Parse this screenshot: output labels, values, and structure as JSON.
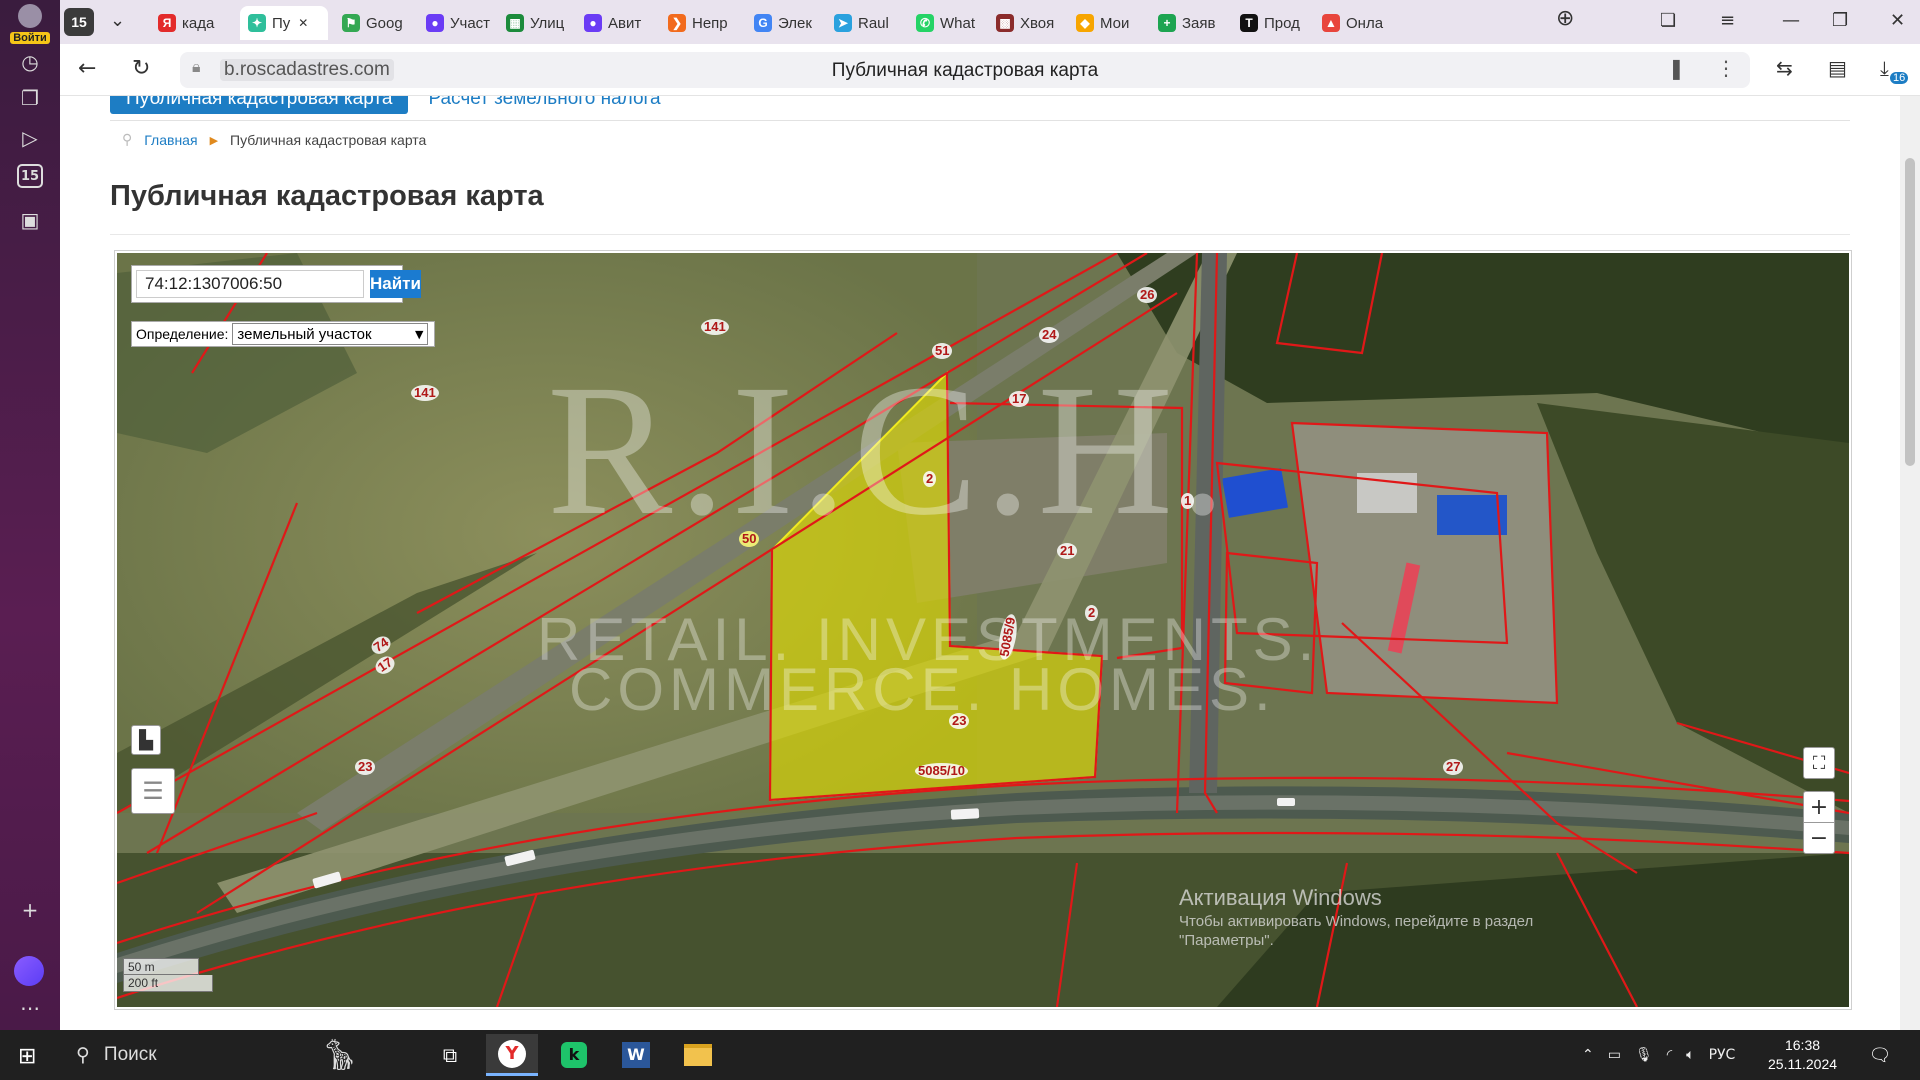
{
  "browser": {
    "profile_label": "Войти",
    "tab_count": "15",
    "tabs": [
      {
        "label": "када",
        "color": "#e32b2b",
        "glyph": "Я"
      },
      {
        "label": "Пу",
        "color": "#2fbf9b",
        "glyph": "✦",
        "active": true
      },
      {
        "label": "Goog",
        "color": "#34a853",
        "glyph": "⚑"
      },
      {
        "label": "Участ",
        "color": "#6b3cf5",
        "glyph": "●"
      },
      {
        "label": "Улиц",
        "color": "#1c8b3c",
        "glyph": "▦"
      },
      {
        "label": "Авит",
        "color": "#6b3cf5",
        "glyph": "●"
      },
      {
        "label": "Непр",
        "color": "#f26b1d",
        "glyph": "❯"
      },
      {
        "label": "Элек",
        "color": "#4285f4",
        "glyph": "G"
      },
      {
        "label": "Raul",
        "color": "#2aa1de",
        "glyph": "➤"
      },
      {
        "label": "What",
        "color": "#25d366",
        "glyph": "✆"
      },
      {
        "label": "Хвоя",
        "color": "#8b2b2b",
        "glyph": "▩"
      },
      {
        "label": "Мои",
        "color": "#f7a500",
        "glyph": "◆"
      },
      {
        "label": "Заяв",
        "color": "#1da451",
        "glyph": "+"
      },
      {
        "label": "Прод",
        "color": "#111111",
        "glyph": "T"
      },
      {
        "label": "Онла",
        "color": "#e8453c",
        "glyph": "▲"
      }
    ],
    "url": "b.roscadastres.com",
    "page_title": "Публичная кадастровая карта",
    "downloads_badge": "16"
  },
  "page": {
    "top_links": {
      "active": "Публичная кадастровая карта",
      "other": "Расчет земельного налога"
    },
    "breadcrumb": {
      "home": "Главная",
      "current": "Публичная кадастровая карта"
    },
    "title": "Публичная кадастровая карта"
  },
  "map": {
    "search_value": "74:12:1307006:50",
    "search_button": "Найти",
    "definition_label": "Определение:",
    "definition_value": "земельный участок",
    "scale": {
      "metric": "50 m",
      "imperial": "200 ft"
    },
    "watermark": {
      "logo": "R.I.C.H.",
      "line1": "RETAIL. INVESTMENTS.",
      "line2": "COMMERCE. HOMES."
    },
    "parcel_labels": [
      "141",
      "141",
      "51",
      "26",
      "24",
      "17",
      "2",
      "1",
      "50",
      "21",
      "2",
      "5085/9",
      "74",
      "17",
      "23",
      "23",
      "5085/10",
      "27"
    ],
    "zoom_in": "+",
    "zoom_out": "−",
    "selected_parcel_color": "#e5e000",
    "boundary_color": "#e01818"
  },
  "windows_activation": {
    "title": "Активация Windows",
    "text": "Чтобы активировать Windows, перейдите в раздел",
    "text2": "\"Параметры\"."
  },
  "taskbar": {
    "search_label": "Поиск",
    "language": "РУС",
    "time": "16:38",
    "date": "25.11.2024"
  }
}
